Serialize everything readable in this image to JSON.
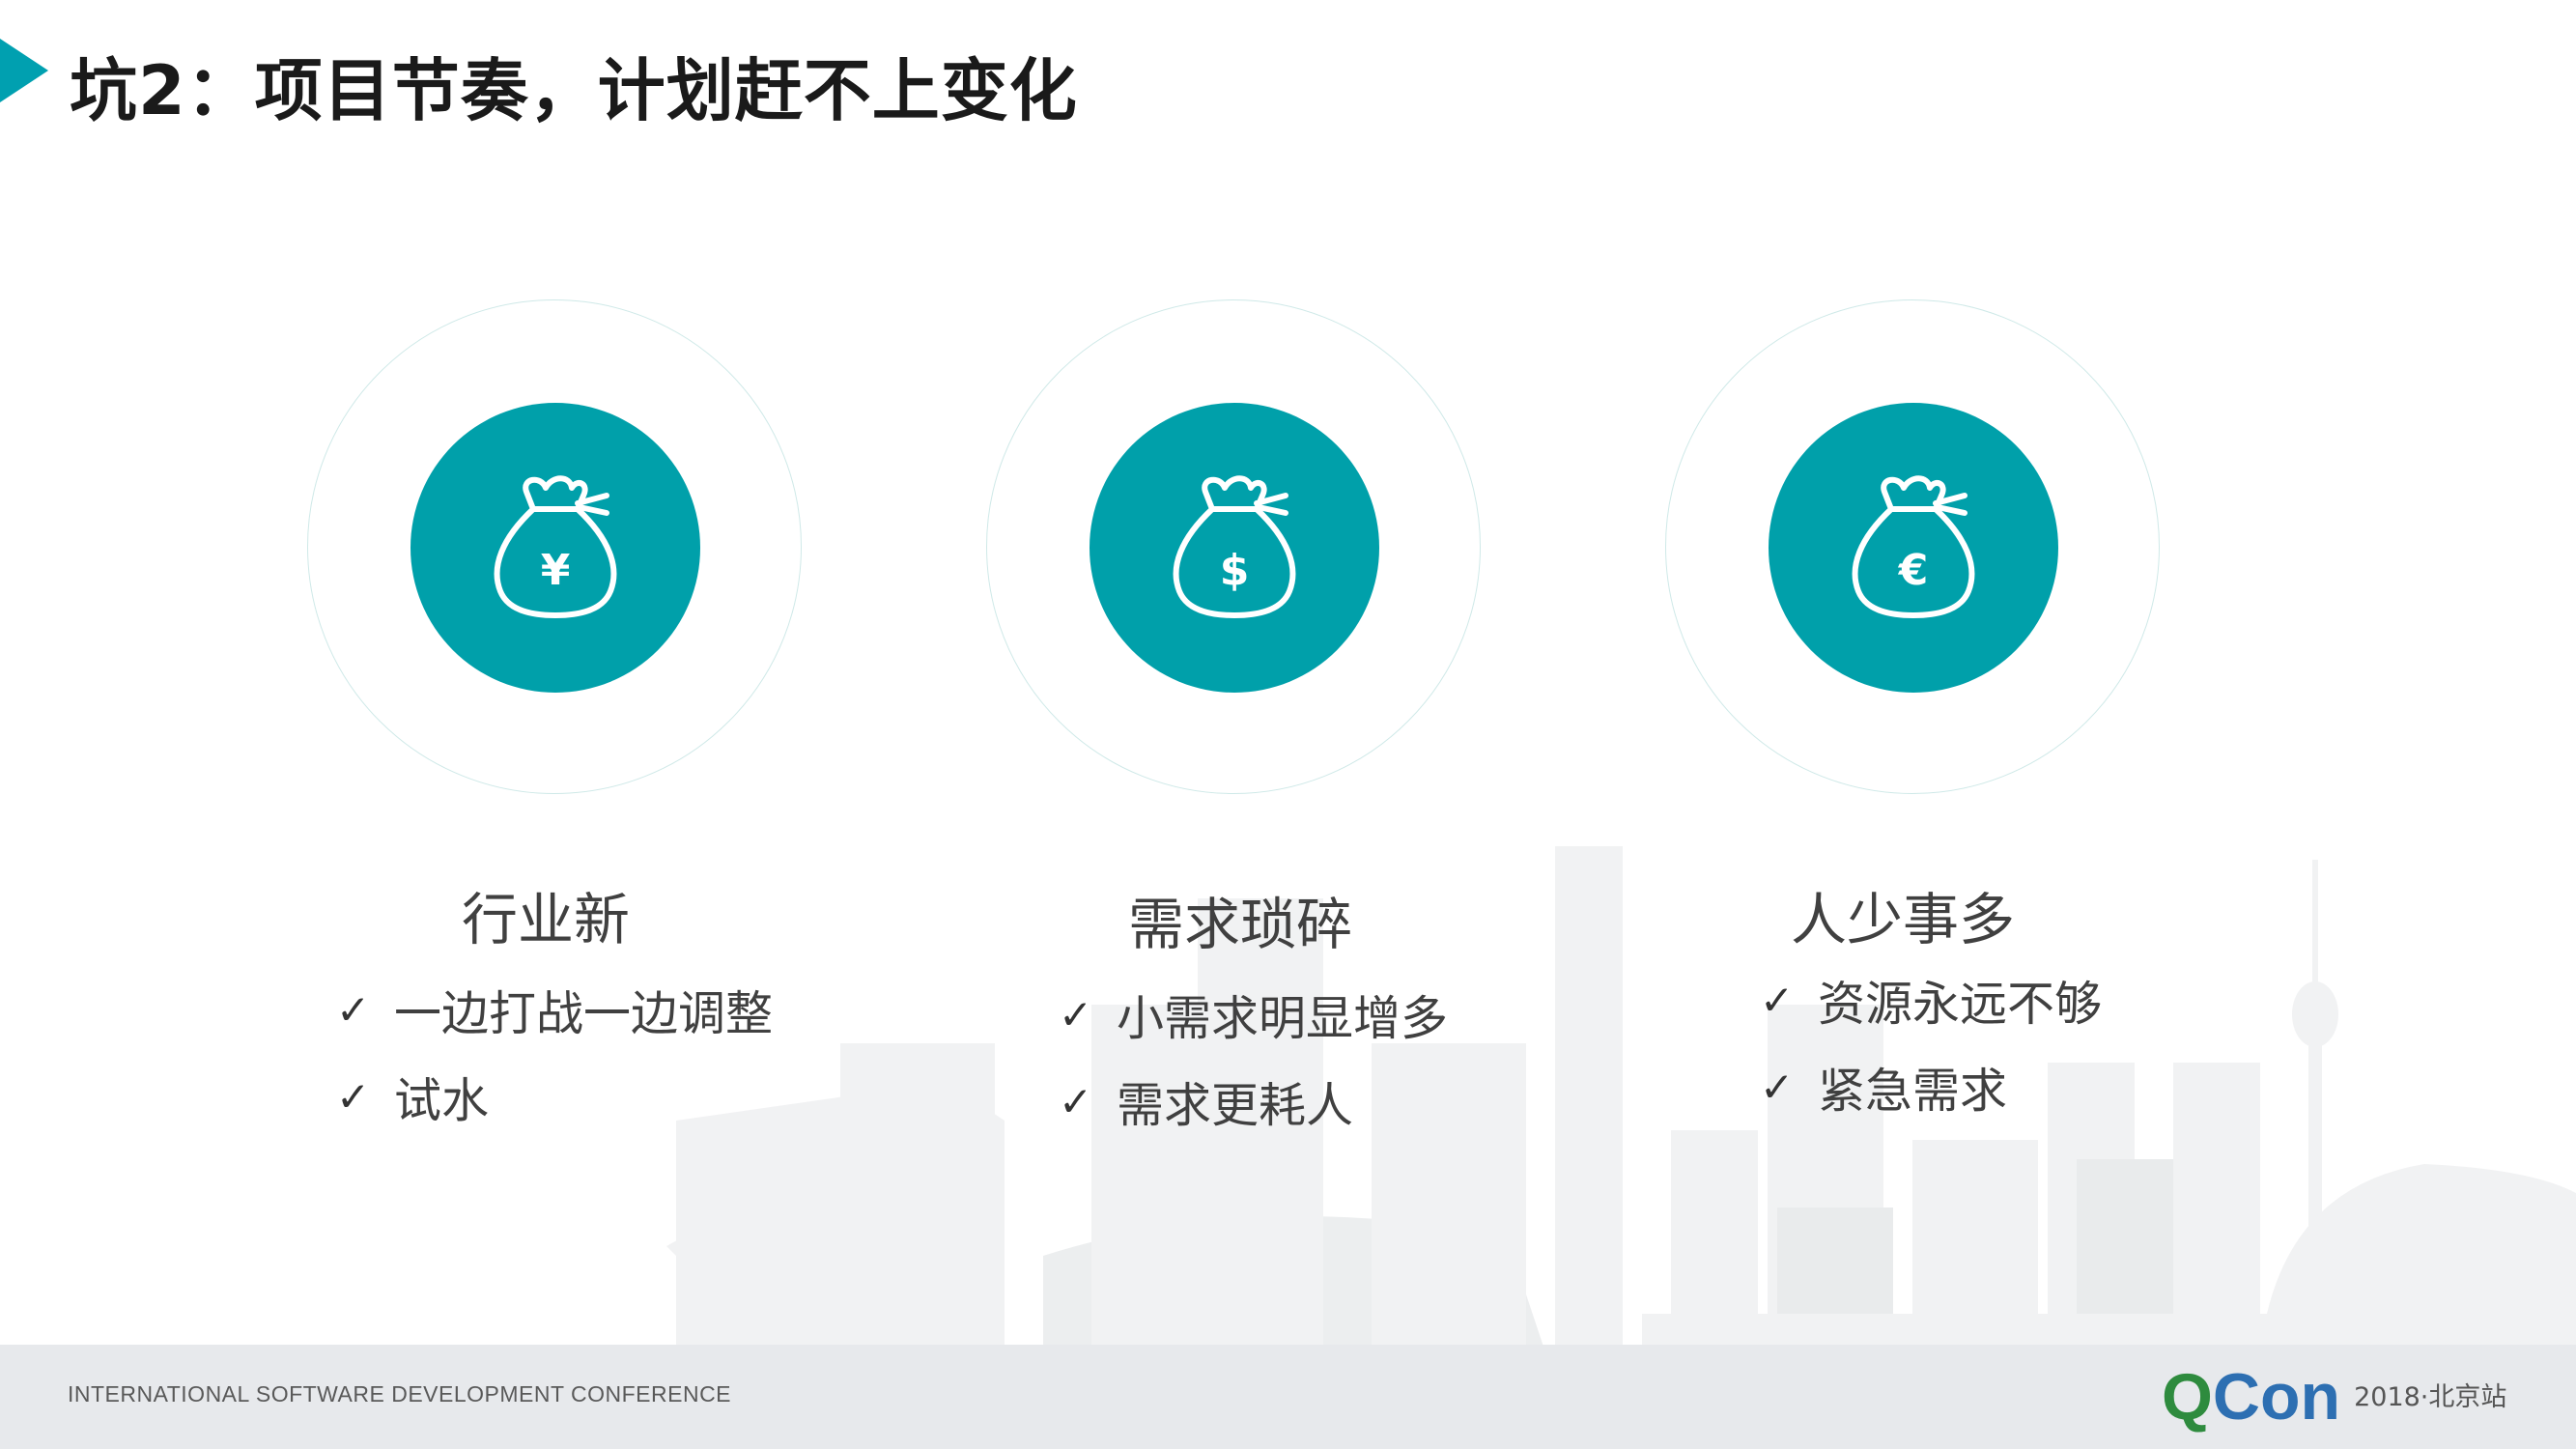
{
  "slide": {
    "title": "坑2：项目节奏，计划赶不上变化"
  },
  "columns": [
    {
      "icon": "yuan-money-bag-icon",
      "symbol": "¥",
      "heading": "行业新",
      "items": [
        "一边打战一边调整",
        "试水"
      ]
    },
    {
      "icon": "dollar-money-bag-icon",
      "symbol": "$",
      "heading": "需求琐碎",
      "items": [
        "小需求明显增多",
        "需求更耗人"
      ]
    },
    {
      "icon": "euro-money-bag-icon",
      "symbol": "€",
      "heading": "人少事多",
      "items": [
        "资源永远不够",
        "紧急需求"
      ]
    }
  ],
  "footer": {
    "conference": "INTERNATIONAL SOFTWARE DEVELOPMENT CONFERENCE",
    "logo_q": "Q",
    "logo_con": "Con",
    "edition": "2018·北京站"
  },
  "colors": {
    "accent": "#00a0aa",
    "ring": "#cfe9e8",
    "text": "#404040",
    "logo_green": "#2e8b3e",
    "logo_blue": "#2d6fb2"
  }
}
